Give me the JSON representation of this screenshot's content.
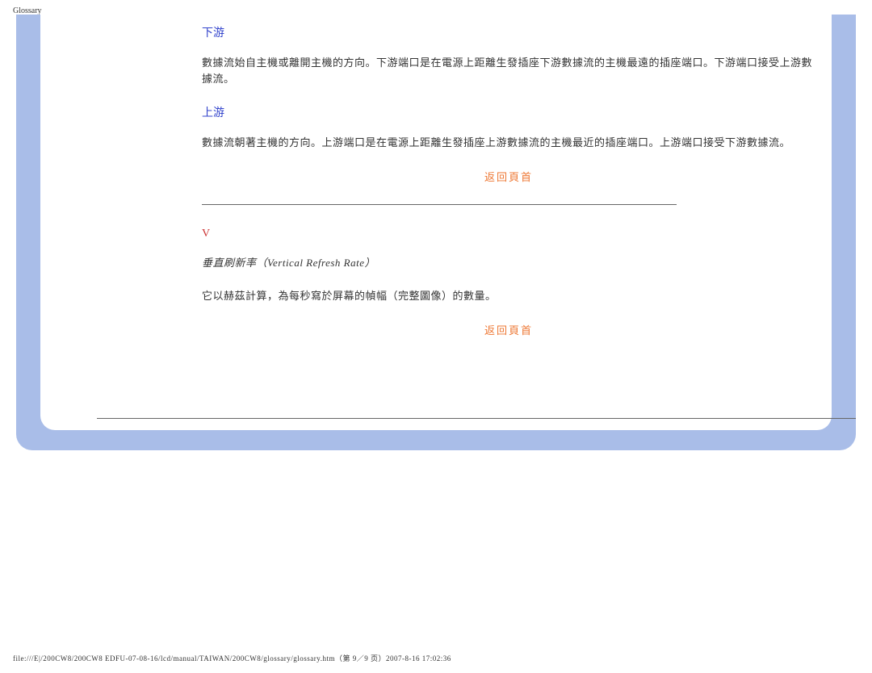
{
  "header": {
    "title": "Glossary"
  },
  "content": {
    "downstream": {
      "heading": "下游",
      "body": "數據流始自主機或離開主機的方向。下游端口是在電源上距離生發插座下游數據流的主機最遠的插座端口。下游端口接受上游數據流。"
    },
    "upstream": {
      "heading": "上游",
      "body": "數據流朝著主機的方向。上游端口是在電源上距離生發插座上游數據流的主機最近的插座端口。上游端口接受下游數據流。"
    },
    "return_link_1": "返回頁首",
    "v_section": {
      "heading": "V",
      "term": "垂直刷新率（Vertical Refresh Rate）",
      "body": "它以赫茲計算，為每秒寫於屏幕的幀幅（完整圖像）的數量。"
    },
    "return_link_2": "返回頁首"
  },
  "footer": {
    "path": "file:///E|/200CW8/200CW8 EDFU-07-08-16/lcd/manual/TAIWAN/200CW8/glossary/glossary.htm（第 9／9 页）2007-8-16 17:02:36"
  }
}
